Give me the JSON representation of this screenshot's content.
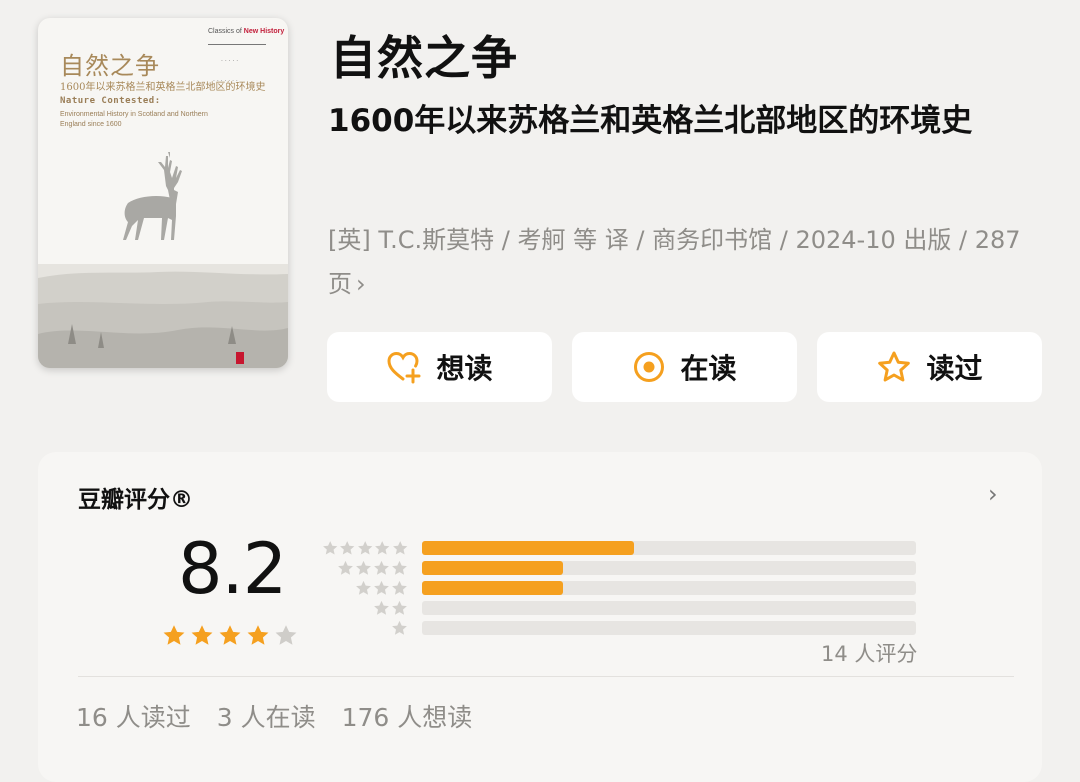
{
  "book": {
    "title": "自然之争",
    "subtitle": "1600年以来苏格兰和英格兰北部地区的环境史",
    "meta": "[英] T.C.斯莫特 / 考舸 等 译 / 商务印书馆 / 2024-10 出版 / 287页",
    "meta_chevron": "›"
  },
  "cover": {
    "series": "New History",
    "title": "自然之争",
    "subtitle": "1600年以来苏格兰和英格兰北部地区的环境史",
    "en_title": "Nature Contested:",
    "en_subtitle": "Environmental History in Scotland and Northern England since 1600"
  },
  "actions": [
    {
      "label": "想读",
      "icon": "heart-plus-icon"
    },
    {
      "label": "在读",
      "icon": "target-icon"
    },
    {
      "label": "读过",
      "icon": "star-outline-icon"
    }
  ],
  "rating": {
    "header": "豆瓣评分®",
    "chevron": "›",
    "score": "8.2",
    "stars_filled": 4,
    "stars_total": 5,
    "distribution": [
      {
        "stars": 5,
        "fraction": 0.43
      },
      {
        "stars": 4,
        "fraction": 0.285
      },
      {
        "stars": 3,
        "fraction": 0.285
      },
      {
        "stars": 2,
        "fraction": 0
      },
      {
        "stars": 1,
        "fraction": 0
      }
    ],
    "count": "14 人评分"
  },
  "stats": {
    "read": "16 人读过",
    "reading": "3 人在读",
    "want": "176 人想读"
  },
  "colors": {
    "accent": "#f5a01f",
    "background": "#f2f1ef",
    "muted_text": "#8f8d89"
  }
}
